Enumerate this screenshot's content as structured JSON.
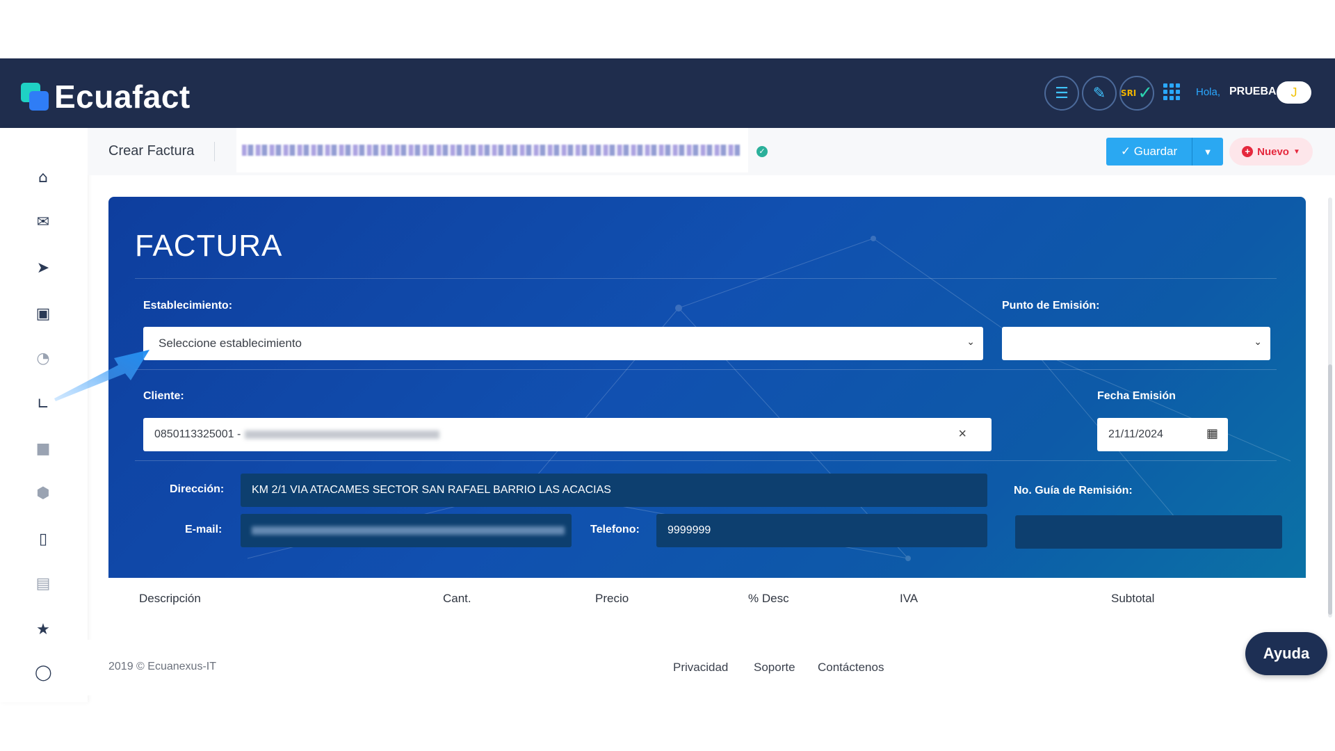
{
  "brand": {
    "name": "Ecuafact",
    "primary_color": "#1f2d4d",
    "accent_color": "#2aa8f2"
  },
  "header": {
    "icons": [
      "invoice-truck-icon",
      "edit-document-icon",
      "sri-check-icon",
      "apps-grid-icon"
    ],
    "sri_label": "SRI",
    "greeting": "Hola,",
    "user_name": "PRUEBA",
    "avatar_initial": "J"
  },
  "sidebar": {
    "icons": [
      "home-icon",
      "mail-icon",
      "send-icon",
      "inbox-icon",
      "pie-chart-icon",
      "line-chart-icon",
      "contacts-icon",
      "box-icon",
      "bar-chart-icon",
      "clipboard-icon",
      "star-icon",
      "toggle-icon"
    ]
  },
  "subheader": {
    "title": "Crear Factura",
    "save_label": "Guardar",
    "new_label": "Nuevo"
  },
  "form": {
    "title": "FACTURA",
    "establecimiento_label": "Establecimiento:",
    "establecimiento_value": "Seleccione establecimiento",
    "punto_emision_label": "Punto de Emisión:",
    "punto_emision_value": "",
    "cliente_label": "Cliente:",
    "cliente_value": "0850113325001 -",
    "fecha_label": "Fecha Emisión",
    "fecha_value": "21/11/2024",
    "direccion_label": "Dirección:",
    "direccion_value": "KM 2/1 VIA ATACAMES SECTOR SAN RAFAEL BARRIO LAS ACACIAS",
    "guia_label": "No. Guía de Remisión:",
    "guia_value": "",
    "email_label": "E-mail:",
    "telefono_label": "Telefono:",
    "telefono_value": "9999999"
  },
  "table": {
    "columns": [
      "Descripción",
      "Cant.",
      "Precio",
      "% Desc",
      "IVA",
      "Subtotal"
    ]
  },
  "footer": {
    "copyright": "2019 © Ecuanexus-IT",
    "links": [
      "Privacidad",
      "Soporte",
      "Contáctenos"
    ],
    "help_label": "Ayuda"
  }
}
